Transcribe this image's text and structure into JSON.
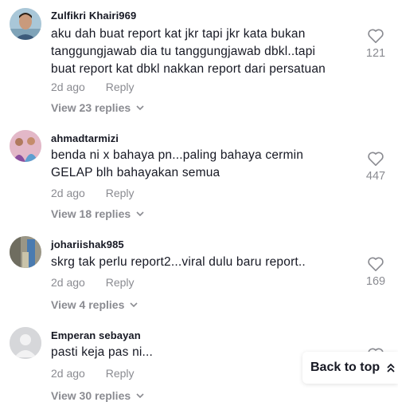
{
  "comments": [
    {
      "username": "Zulfikri Khairi969",
      "text": "aku dah buat report kat jkr tapi jkr kata bukan tanggungjawab dia tu tanggungjawab dbkl..tapi buat report kat dbkl nakkan report dari persatuan",
      "time": "2d ago",
      "reply_label": "Reply",
      "view_replies": "View 23 replies",
      "likes": "121",
      "avatar": "person-photo"
    },
    {
      "username": "ahmadtarmizi",
      "text": "benda ni x bahaya pn...paling bahaya cermin GELAP blh bahayakan semua",
      "time": "2d ago",
      "reply_label": "Reply",
      "view_replies": "View 18 replies",
      "likes": "447",
      "avatar": "group-photo"
    },
    {
      "username": "johariishak985",
      "text": "skrg tak perlu report2...viral dulu baru report..",
      "time": "2d ago",
      "reply_label": "Reply",
      "view_replies": "View 4 replies",
      "likes": "169",
      "avatar": "outdoor-photo"
    },
    {
      "username": "Emperan sebayan",
      "text": "pasti keja pas ni...",
      "time": "2d ago",
      "reply_label": "Reply",
      "view_replies": "View 30 replies",
      "likes": "",
      "avatar": "default-avatar"
    }
  ],
  "back_to_top": {
    "label": "Back to top",
    "icon": "double-chevron-up-icon"
  },
  "icons": {
    "like": "heart-outline-icon",
    "expand": "chevron-down-icon"
  },
  "colors": {
    "primary_text": "#161823",
    "secondary_text": "#8a8b91"
  }
}
